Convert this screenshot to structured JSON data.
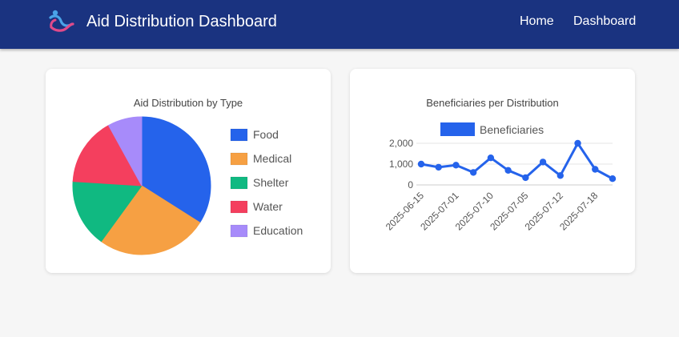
{
  "header": {
    "title": "Aid Distribution Dashboard",
    "logo_icon": "people-hands-logo-icon",
    "nav": [
      {
        "label": "Home"
      },
      {
        "label": "Dashboard"
      }
    ],
    "background_color": "#1a3380"
  },
  "charts": {
    "pie": {
      "title": "Aid Distribution by Type"
    },
    "line": {
      "title": "Beneficiaries per Distribution"
    }
  },
  "chart_data": [
    {
      "type": "pie",
      "title": "Aid Distribution by Type",
      "legend_position": "right",
      "categories": [
        "Food",
        "Medical",
        "Shelter",
        "Water",
        "Education"
      ],
      "values": [
        34,
        26,
        16,
        16,
        8
      ],
      "colors": [
        "#2563eb",
        "#f6a043",
        "#10b981",
        "#f43f5e",
        "#a78bfa"
      ]
    },
    {
      "type": "line",
      "title": "Beneficiaries per Distribution",
      "legend_position": "top",
      "series": [
        {
          "name": "Beneficiaries",
          "color": "#2563eb",
          "values": [
            1000,
            850,
            950,
            600,
            1300,
            700,
            350,
            1100,
            450,
            2000,
            750,
            300
          ]
        }
      ],
      "x": [
        "2025-06-15",
        "",
        "2025-07-01",
        "",
        "2025-07-10",
        "",
        "2025-07-05",
        "",
        "2025-07-12",
        "",
        "2025-07-18",
        ""
      ],
      "x_tick_labels": [
        "2025-06-15",
        "2025-07-01",
        "2025-07-10",
        "2025-07-05",
        "2025-07-12",
        "2025-07-18"
      ],
      "y_ticks": [
        "0",
        "1,000",
        "2,000"
      ],
      "ylim": [
        0,
        2000
      ],
      "grid": true
    }
  ]
}
